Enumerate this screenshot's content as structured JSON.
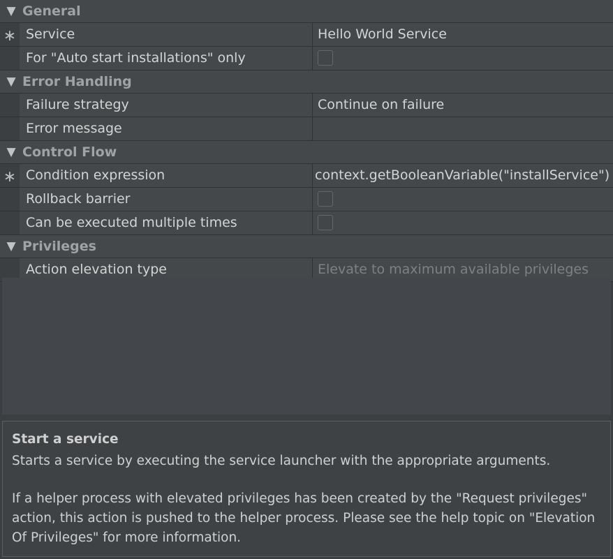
{
  "sections": {
    "general": {
      "title": "General",
      "service_label": "Service",
      "service_value": "Hello World Service",
      "auto_start_label": "For \"Auto start installations\" only",
      "auto_start_checked": false
    },
    "error_handling": {
      "title": "Error Handling",
      "failure_label": "Failure strategy",
      "failure_value": "Continue on failure",
      "error_message_label": "Error message",
      "error_message_value": ""
    },
    "control_flow": {
      "title": "Control Flow",
      "condition_label": "Condition expression",
      "condition_value": "context.getBooleanVariable(\"installService\")",
      "rollback_label": "Rollback barrier",
      "rollback_checked": false,
      "multiple_label": "Can be executed multiple times",
      "multiple_checked": false
    },
    "privileges": {
      "title": "Privileges",
      "elevation_label": "Action elevation type",
      "elevation_value": "Elevate to maximum available privileges"
    }
  },
  "required_marker": "∗",
  "help": {
    "title": "Start a service",
    "line1": "Starts a service by executing the service launcher with the appropriate arguments.",
    "para2_l1": "If a helper process with elevated privileges has been created by the \"Request privileges\"",
    "para2_l2": "action, this action is pushed to the helper process. Please see the help topic on \"Elevation",
    "para2_l3": "Of Privileges\" for more information."
  }
}
